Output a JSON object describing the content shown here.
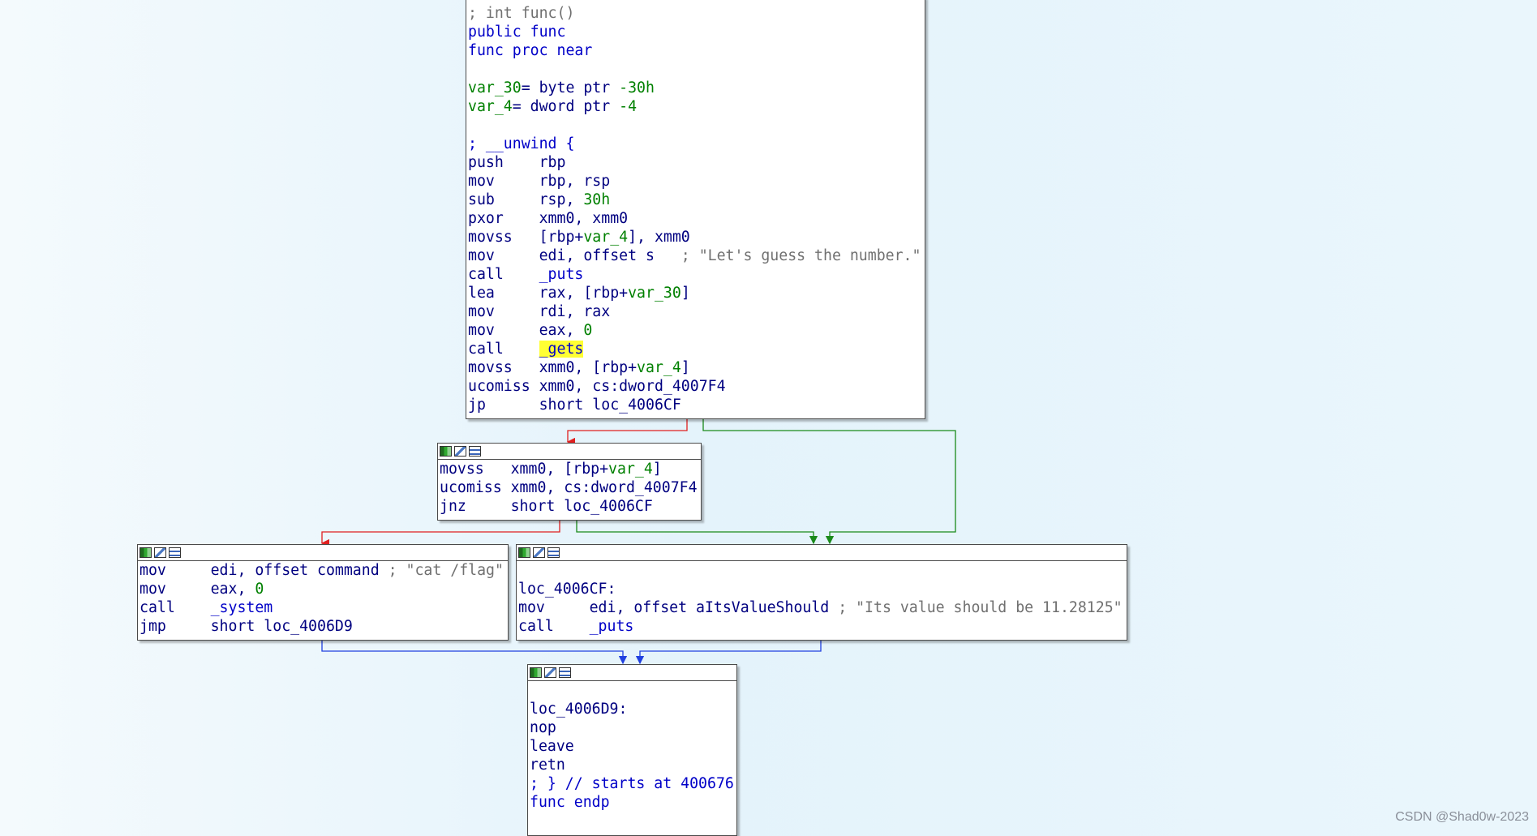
{
  "nodes": {
    "func_block": {
      "lines": [
        {
          "segs": [
            {
              "t": "; int func()",
              "c": "gray"
            }
          ]
        },
        {
          "segs": [
            {
              "t": "public func",
              "c": "blue"
            }
          ]
        },
        {
          "segs": [
            {
              "t": "func proc near",
              "c": "blue"
            }
          ]
        },
        {
          "segs": []
        },
        {
          "segs": [
            {
              "t": "var_30",
              "c": "green"
            },
            {
              "t": "= byte ptr ",
              "c": "navy"
            },
            {
              "t": "-30h",
              "c": "green"
            }
          ]
        },
        {
          "segs": [
            {
              "t": "var_4",
              "c": "green"
            },
            {
              "t": "= dword ptr ",
              "c": "navy"
            },
            {
              "t": "-4",
              "c": "green"
            }
          ]
        },
        {
          "segs": []
        },
        {
          "segs": [
            {
              "t": "; __unwind {",
              "c": "blue"
            }
          ]
        },
        {
          "segs": [
            {
              "t": "push    rbp",
              "c": "navy"
            }
          ]
        },
        {
          "segs": [
            {
              "t": "mov     rbp, rsp",
              "c": "navy"
            }
          ]
        },
        {
          "segs": [
            {
              "t": "sub     rsp, ",
              "c": "navy"
            },
            {
              "t": "30h",
              "c": "green"
            }
          ]
        },
        {
          "segs": [
            {
              "t": "pxor    xmm0, xmm0",
              "c": "navy"
            }
          ]
        },
        {
          "segs": [
            {
              "t": "movss   [rbp+",
              "c": "navy"
            },
            {
              "t": "var_4",
              "c": "green"
            },
            {
              "t": "], xmm0",
              "c": "navy"
            }
          ]
        },
        {
          "segs": [
            {
              "t": "mov     edi, offset s   ",
              "c": "navy"
            },
            {
              "t": "; \"Let's guess the number.\"",
              "c": "gray"
            }
          ]
        },
        {
          "segs": [
            {
              "t": "call    ",
              "c": "navy"
            },
            {
              "t": "_puts",
              "c": "blue"
            }
          ]
        },
        {
          "segs": [
            {
              "t": "lea     rax, [rbp+",
              "c": "navy"
            },
            {
              "t": "var_30",
              "c": "green"
            },
            {
              "t": "]",
              "c": "navy"
            }
          ]
        },
        {
          "segs": [
            {
              "t": "mov     rdi, rax",
              "c": "navy"
            }
          ]
        },
        {
          "segs": [
            {
              "t": "mov     eax, ",
              "c": "navy"
            },
            {
              "t": "0",
              "c": "green"
            }
          ]
        },
        {
          "segs": [
            {
              "t": "call    ",
              "c": "navy"
            },
            {
              "t": "_gets",
              "c": "blue",
              "hl": true
            }
          ]
        },
        {
          "segs": [
            {
              "t": "movss   xmm0, [rbp+",
              "c": "navy"
            },
            {
              "t": "var_4",
              "c": "green"
            },
            {
              "t": "]",
              "c": "navy"
            }
          ]
        },
        {
          "segs": [
            {
              "t": "ucomiss xmm0, cs:dword_4007F4",
              "c": "navy"
            }
          ]
        },
        {
          "segs": [
            {
              "t": "jp      short loc_4006CF",
              "c": "navy"
            }
          ]
        }
      ]
    },
    "cmp_block": {
      "lines": [
        {
          "segs": [
            {
              "t": "movss   xmm0, [rbp+",
              "c": "navy"
            },
            {
              "t": "var_4",
              "c": "green"
            },
            {
              "t": "]",
              "c": "navy"
            }
          ]
        },
        {
          "segs": [
            {
              "t": "ucomiss xmm0, cs:dword_4007F4",
              "c": "navy"
            }
          ]
        },
        {
          "segs": [
            {
              "t": "jnz     short loc_4006CF",
              "c": "navy"
            }
          ]
        }
      ]
    },
    "flag_block": {
      "lines": [
        {
          "segs": [
            {
              "t": "mov     edi, offset command ",
              "c": "navy"
            },
            {
              "t": "; \"cat /flag\"",
              "c": "gray"
            }
          ]
        },
        {
          "segs": [
            {
              "t": "mov     eax, ",
              "c": "navy"
            },
            {
              "t": "0",
              "c": "green"
            }
          ]
        },
        {
          "segs": [
            {
              "t": "call    ",
              "c": "navy"
            },
            {
              "t": "_system",
              "c": "blue"
            }
          ]
        },
        {
          "segs": [
            {
              "t": "jmp     short loc_4006D9",
              "c": "navy"
            }
          ]
        }
      ]
    },
    "fail_block": {
      "lines": [
        {
          "segs": []
        },
        {
          "segs": [
            {
              "t": "loc_4006CF:",
              "c": "navy"
            }
          ]
        },
        {
          "segs": [
            {
              "t": "mov     edi, offset aItsValueShould ",
              "c": "navy"
            },
            {
              "t": "; \"Its value should be 11.28125\"",
              "c": "gray"
            }
          ]
        },
        {
          "segs": [
            {
              "t": "call    ",
              "c": "navy"
            },
            {
              "t": "_puts",
              "c": "blue"
            }
          ]
        }
      ]
    },
    "end_block": {
      "lines": [
        {
          "segs": []
        },
        {
          "segs": [
            {
              "t": "loc_4006D9:",
              "c": "navy"
            }
          ]
        },
        {
          "segs": [
            {
              "t": "nop",
              "c": "navy"
            }
          ]
        },
        {
          "segs": [
            {
              "t": "leave",
              "c": "navy"
            }
          ]
        },
        {
          "segs": [
            {
              "t": "retn",
              "c": "navy"
            }
          ]
        },
        {
          "segs": [
            {
              "t": "; } // starts at 400676",
              "c": "blue"
            }
          ]
        },
        {
          "segs": [
            {
              "t": "func endp",
              "c": "blue"
            }
          ]
        }
      ]
    }
  },
  "edge_colors": {
    "false_branch": "#e02020",
    "true_branch": "#1a8a1a",
    "jump": "#2040e0"
  },
  "watermark": "CSDN @Shad0w-2023"
}
